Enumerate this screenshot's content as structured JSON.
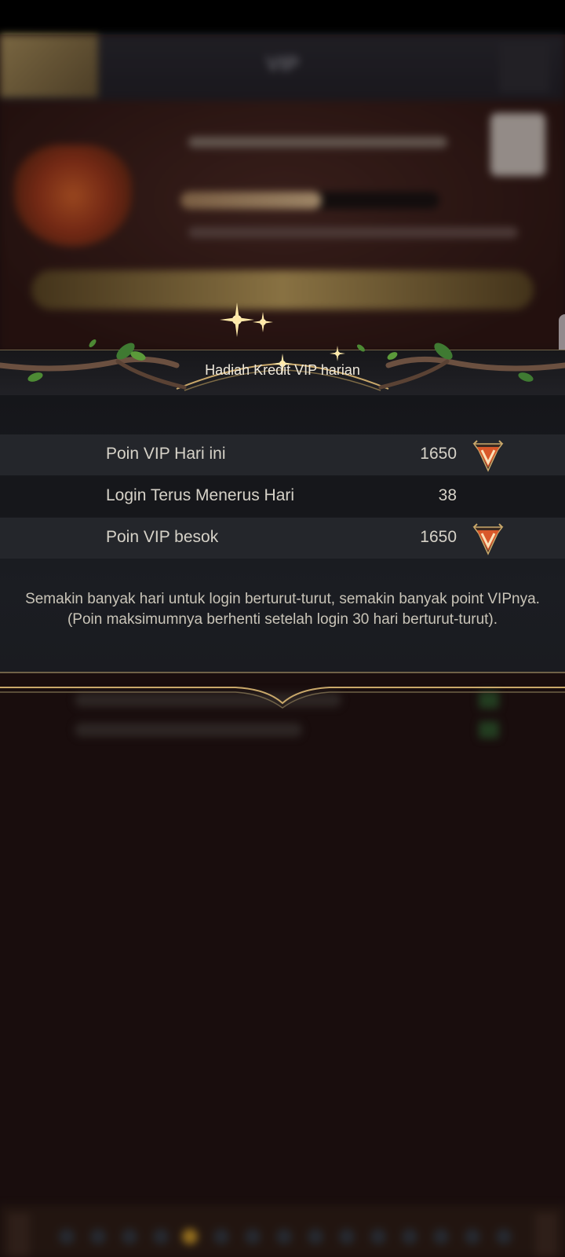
{
  "popup": {
    "title": "Hadiah Kredit VIP harian",
    "rows": [
      {
        "label": "Poin VIP Hari ini",
        "value": "1650",
        "icon": "vip-point-icon"
      },
      {
        "label": "Login Terus Menerus Hari",
        "value": "38"
      },
      {
        "label": "Poin VIP besok",
        "value": "1650",
        "icon": "vip-point-icon"
      }
    ],
    "note": "Semakin banyak hari untuk login berturut-turut, semakin banyak point VIPnya. (Poin maksimumnya berhenti setelah login 30 hari berturut-turut)."
  },
  "background": {
    "header_title": "VIP"
  },
  "colors": {
    "gold_frame": "#c9a86a",
    "text": "#d6d2c8",
    "vip_icon": "#d9582a"
  }
}
